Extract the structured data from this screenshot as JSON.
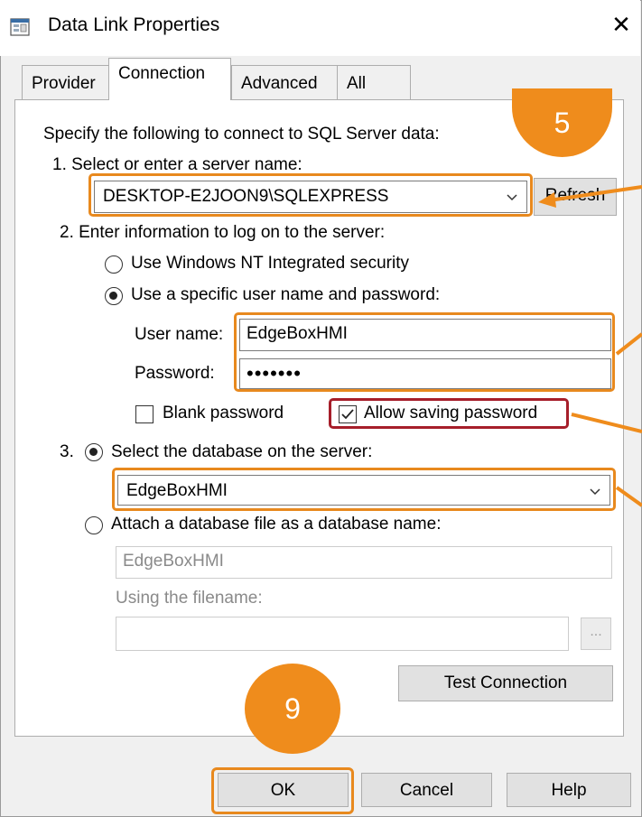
{
  "window": {
    "title": "Data Link Properties",
    "close_glyph": "✕"
  },
  "tabs": [
    {
      "label": "Provider"
    },
    {
      "label": "Connection"
    },
    {
      "label": "Advanced"
    },
    {
      "label": "All"
    }
  ],
  "connection": {
    "intro": "Specify the following to connect to SQL Server data:",
    "step1_label": "1. Select or enter a server name:",
    "server_name": "DESKTOP-E2JOON9\\SQLEXPRESS",
    "refresh_label": "Refresh",
    "step2_label": "2. Enter information to log on to the server:",
    "radio_nt": "Use Windows NT Integrated security",
    "radio_specific": "Use a specific user name and password:",
    "username_label": "User name:",
    "username_value": "EdgeBoxHMI",
    "password_label": "Password:",
    "password_value": "•••••••",
    "blank_password_label": "Blank password",
    "blank_password_checked": false,
    "allow_saving_label": "Allow saving password",
    "allow_saving_checked": true,
    "step3_label": "3.",
    "radio_select_db": "Select the database on the server:",
    "database_value": "EdgeBoxHMI",
    "radio_attach": "Attach a database file as a database name:",
    "attach_db_name": "EdgeBoxHMI",
    "filename_label": "Using the filename:",
    "filename_value": "",
    "browse_label": "...",
    "test_connection_label": "Test Connection"
  },
  "footer": {
    "ok_label": "OK",
    "cancel_label": "Cancel",
    "help_label": "Help"
  },
  "annotations": {
    "step_5": "5",
    "step_9": "9"
  },
  "colors": {
    "highlight_orange": "#e8891e",
    "highlight_red": "#a61e2a",
    "badge_orange": "#ef8c1c",
    "dialog_bg": "#f0f0f0"
  }
}
